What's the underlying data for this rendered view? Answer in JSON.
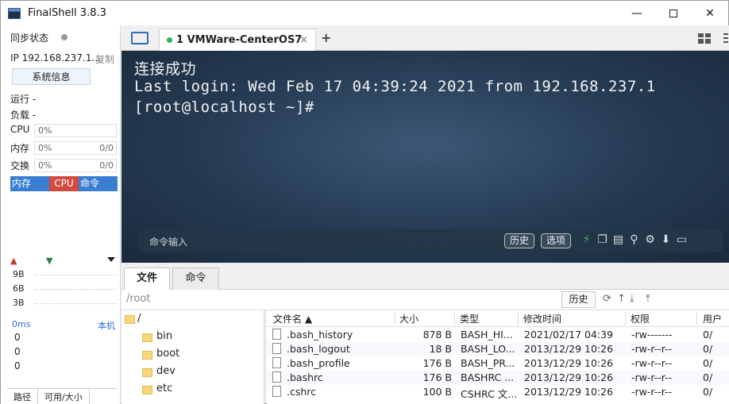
{
  "window": {
    "title": "FinalShell 3.8.3",
    "controls": [
      "minimize",
      "maximize",
      "close"
    ]
  },
  "left": {
    "sync_label": "同步状态",
    "ip": "IP 192.168.237.1...",
    "copy": "复制",
    "sysinfo": "系统信息",
    "uptime_label": "运行 -",
    "load_label": "负载 -",
    "cpu": {
      "label": "CPU",
      "value": "0%"
    },
    "mem": {
      "label": "内存",
      "value": "0%",
      "ratio": "0/0"
    },
    "swap": {
      "label": "交换",
      "value": "0%",
      "ratio": "0/0"
    },
    "tabs": [
      {
        "label": "内存",
        "color": "#3a7ed1"
      },
      {
        "label": "CPU",
        "color": "#d24b3f"
      },
      {
        "label": "命令",
        "color": "#3a7ed1"
      }
    ],
    "net_scale": [
      "9B",
      "6B",
      "3B"
    ],
    "latency": "0ms",
    "local": "本机",
    "zeros": [
      "0",
      "0",
      "0"
    ],
    "bottom_cols": [
      "路径",
      "可用/大小"
    ]
  },
  "session": {
    "tab_label": "1 VMWare-CenterOS7",
    "close": "×",
    "add": "+"
  },
  "terminal": {
    "lines": [
      "连接成功",
      "Last login: Wed Feb 17 04:39:24 2021 from 192.168.237.1",
      "[root@localhost ~]#"
    ],
    "cmd_placeholder": "命令输入",
    "history_btn": "历史",
    "options_btn": "选项"
  },
  "files": {
    "tabs": [
      "文件",
      "命令"
    ],
    "path": "/root",
    "history_btn": "历史",
    "tree": [
      "/",
      "bin",
      "boot",
      "dev",
      "etc"
    ],
    "headers": [
      "文件名 ▲",
      "大小",
      "类型",
      "修改时间",
      "权限",
      "用户"
    ],
    "rows": [
      {
        "name": ".bash_history",
        "size": "878 B",
        "type": "BASH_HI...",
        "mtime": "2021/02/17 04:39",
        "perm": "-rw-------",
        "user": "0/"
      },
      {
        "name": ".bash_logout",
        "size": "18 B",
        "type": "BASH_LO...",
        "mtime": "2013/12/29 10:26",
        "perm": "-rw-r--r--",
        "user": "0/"
      },
      {
        "name": ".bash_profile",
        "size": "176 B",
        "type": "BASH_PR...",
        "mtime": "2013/12/29 10:26",
        "perm": "-rw-r--r--",
        "user": "0/"
      },
      {
        "name": ".bashrc",
        "size": "176 B",
        "type": "BASHRC ...",
        "mtime": "2013/12/29 10:26",
        "perm": "-rw-r--r--",
        "user": "0/"
      },
      {
        "name": ".cshrc",
        "size": "100 B",
        "type": "CSHRC 文...",
        "mtime": "2013/12/29 10:26",
        "perm": "-rw-r--r--",
        "user": "0/"
      }
    ]
  },
  "colors": {
    "accent": "#3a7ed1",
    "cpu": "#d24b3f",
    "terminal_bg": "#253a52",
    "online": "#2db84a"
  }
}
